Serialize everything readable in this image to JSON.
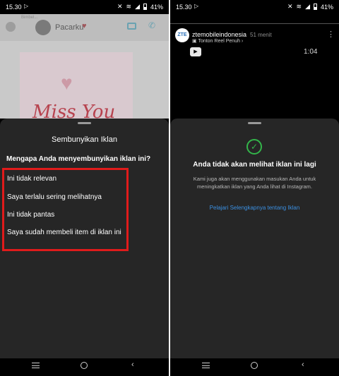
{
  "left": {
    "status": {
      "time": "15.30",
      "battery": "41%"
    },
    "chat": {
      "contact_name": "Pacarku",
      "ghost_text": "Bimbel...",
      "card_text": "Miss You"
    },
    "sheet": {
      "title": "Sembunyikan Iklan",
      "question": "Mengapa Anda menyembunyikan iklan ini?",
      "reasons": [
        "Ini tidak relevan",
        "Saya terlalu sering melihatnya",
        "Ini tidak pantas",
        "Saya sudah membeli item di iklan ini"
      ]
    }
  },
  "right": {
    "status": {
      "time": "15.30",
      "battery": "41%"
    },
    "reel": {
      "logo_text": "ZTE",
      "account": "ztemobileindonesia",
      "time_ago": "51 menit",
      "subtitle": "Tonton Reel Penuh",
      "duration": "1:04"
    },
    "sheet": {
      "title": "Anda tidak akan melihat iklan ini lagi",
      "body": "Kami juga akan menggunakan masukan Anda untuk meningkatkan iklan yang Anda lihat di Instagram.",
      "link": "Pelajari Selengkapnya tentang Iklan"
    }
  },
  "colors": {
    "highlight": "#e01b1b",
    "check": "#33b54a",
    "link": "#3b8fe0",
    "sheet_bg": "#262626"
  },
  "icons": [
    "play-icon",
    "mute-icon",
    "wifi-icon",
    "signal-icon",
    "battery-icon",
    "video-call-icon",
    "phone-icon",
    "check-icon",
    "more-icon",
    "menu-icon",
    "home-icon",
    "back-icon"
  ]
}
